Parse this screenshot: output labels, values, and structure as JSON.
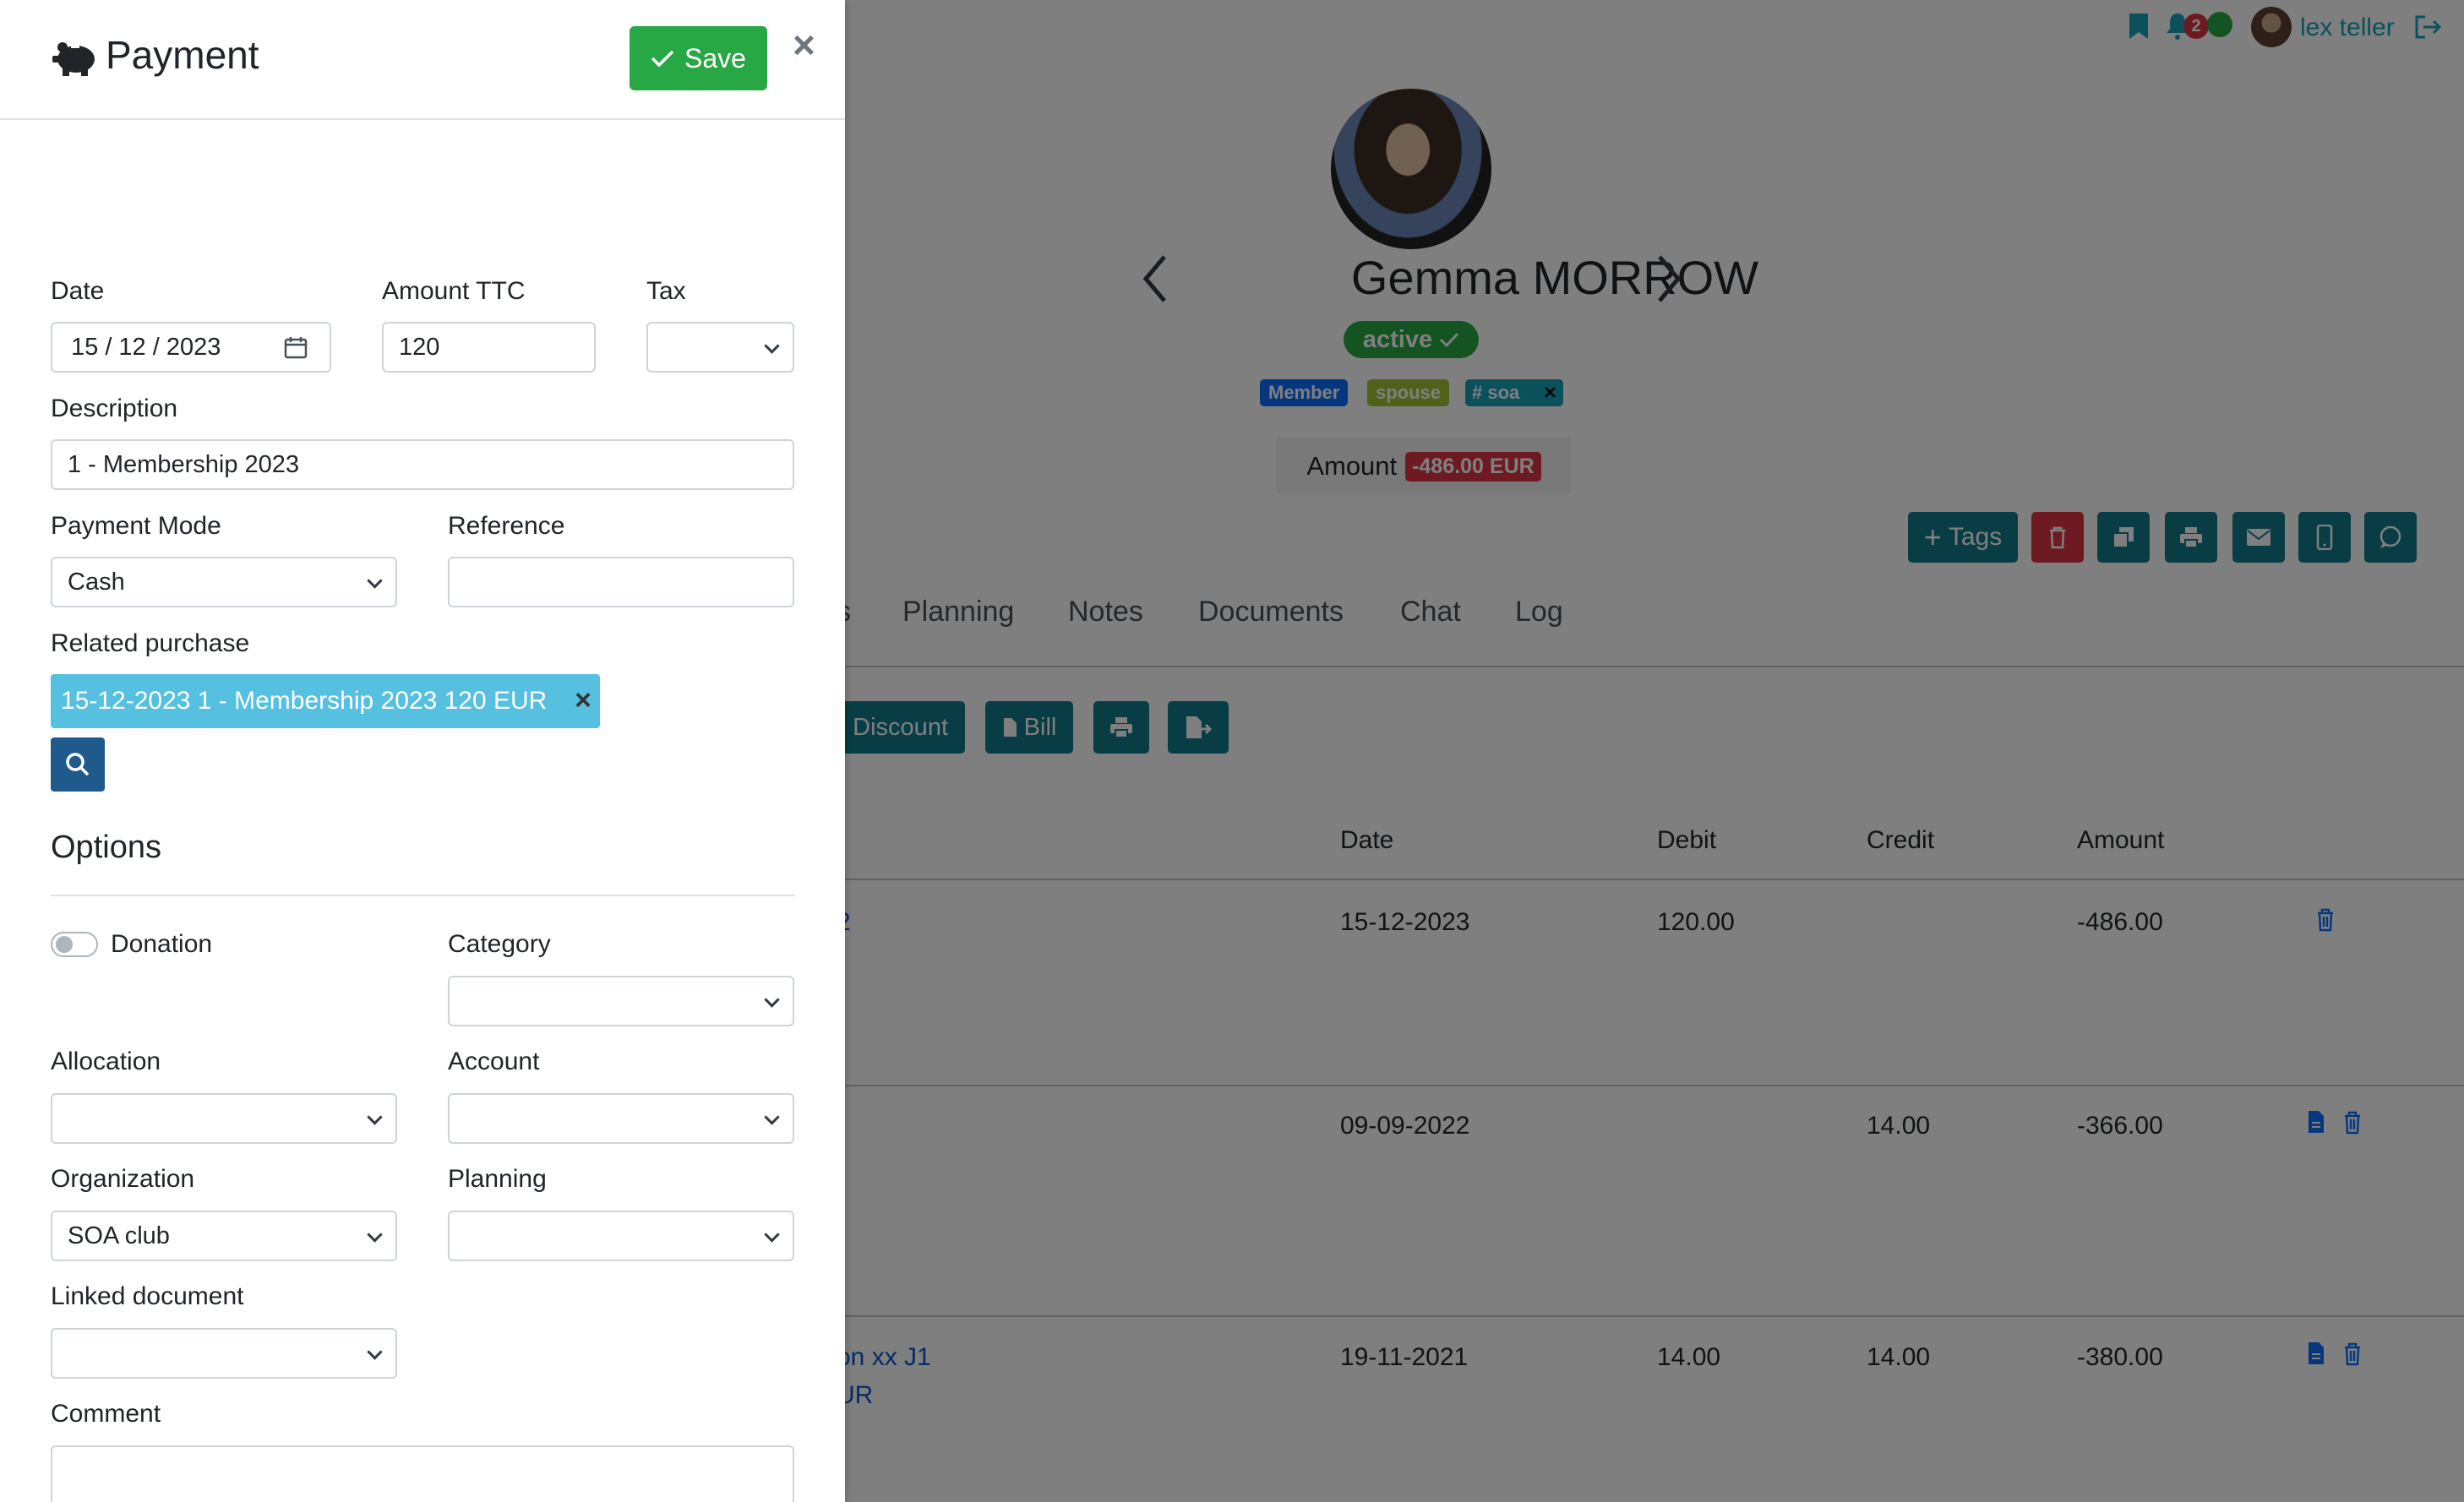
{
  "background_page": {
    "topbar": {
      "notification_count": "2",
      "user_name": "lex teller"
    },
    "profile": {
      "name": "Gemma MORROW",
      "status": "active",
      "tags": [
        "Member",
        "spouse",
        "# soa"
      ],
      "amount_label": "Amount",
      "amount_value": "-486.00 EUR"
    },
    "actions": {
      "tags_label": "Tags"
    },
    "tabs": [
      "s",
      "Planning",
      "Notes",
      "Documents",
      "Chat",
      "Log"
    ],
    "toolbar": {
      "discount_label": "Discount",
      "bill_label": "Bill"
    },
    "table": {
      "headers": [
        "Date",
        "Debit",
        "Credit",
        "Amount"
      ],
      "rows": [
        {
          "label": "2",
          "label2": "",
          "date": "15-12-2023",
          "debit": "120.00",
          "credit": "",
          "amount": "-486.00"
        },
        {
          "label": "",
          "label2": "",
          "date": "09-09-2022",
          "debit": "",
          "credit": "14.00",
          "amount": "-366.00"
        },
        {
          "label": "on xx J1",
          "label2": "UR",
          "date": "19-11-2021",
          "debit": "14.00",
          "credit": "14.00",
          "amount": "-380.00"
        }
      ]
    }
  },
  "panel": {
    "title": "Payment",
    "save_label": "Save",
    "close_symbol": "×",
    "fields": {
      "date": {
        "label": "Date",
        "value": "15 / 12 / 2023"
      },
      "amount": {
        "label": "Amount TTC",
        "value": "120"
      },
      "tax": {
        "label": "Tax",
        "value": ""
      },
      "description": {
        "label": "Description",
        "value": "1 - Membership 2023"
      },
      "payment_mode": {
        "label": "Payment Mode",
        "value": "Cash"
      },
      "reference": {
        "label": "Reference",
        "value": ""
      },
      "related_purchase": {
        "label": "Related purchase",
        "chip": "15-12-2023 1 - Membership 2023 120 EUR"
      }
    },
    "options": {
      "heading": "Options",
      "donation_label": "Donation",
      "category_label": "Category",
      "allocation_label": "Allocation",
      "account_label": "Account",
      "organization_label": "Organization",
      "organization_value": "SOA club",
      "planning_label": "Planning",
      "linked_document_label": "Linked document",
      "comment_label": "Comment"
    }
  },
  "colors": {
    "save_green": "#28a745",
    "chip_cyan": "#56c0e0",
    "teal": "#17a2b8",
    "danger": "#dc3545",
    "link_blue": "#0d6efd"
  }
}
